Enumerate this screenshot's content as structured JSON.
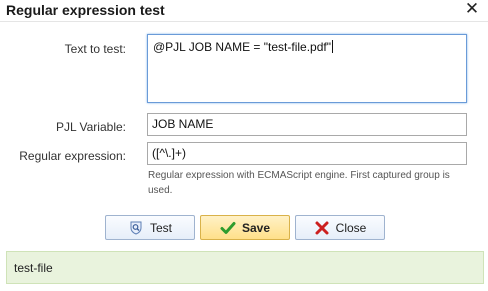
{
  "dialog": {
    "title": "Regular expression test",
    "close_icon": "close-icon"
  },
  "form": {
    "text_to_test": {
      "label": "Text to test:",
      "value": "@PJL JOB NAME = \"test-file.pdf\""
    },
    "pjl_variable": {
      "label": "PJL Variable:",
      "value": "JOB NAME"
    },
    "regular_expression": {
      "label": "Regular expression:",
      "value": "([^\\.]+)",
      "hint": "Regular expression with ECMAScript engine. First captured group is used."
    }
  },
  "buttons": {
    "test": {
      "label": "Test",
      "icon": "test-icon"
    },
    "save": {
      "label": "Save",
      "icon": "checkmark-icon"
    },
    "close": {
      "label": "Close",
      "icon": "x-icon"
    }
  },
  "result": {
    "text": "test-file"
  },
  "colors": {
    "save_bg": "#ffe08a",
    "result_bg": "#e9f3dd",
    "close_x": "#cc1f1f",
    "check": "#2e9c2e",
    "active_border": "#6a9bd8"
  }
}
